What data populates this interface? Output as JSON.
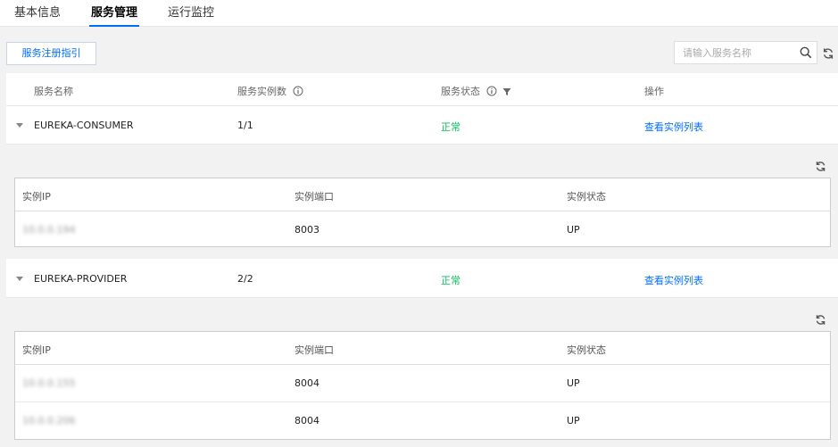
{
  "tabs": [
    "基本信息",
    "服务管理",
    "运行监控"
  ],
  "toolbar": {
    "guide_label": "服务注册指引",
    "search_placeholder": "请输入服务名称"
  },
  "table": {
    "headers": [
      "服务名称",
      "服务实例数",
      "服务状态",
      "操作"
    ],
    "services": [
      {
        "name": "EUREKA-CONSUMER",
        "instances": "1/1",
        "status": "正常",
        "action": "查看实例列表",
        "sub_headers": [
          "实例IP",
          "实例端口",
          "实例状态"
        ],
        "rows": [
          {
            "ip": "10.0.0.194",
            "port": "8003",
            "state": "UP"
          }
        ]
      },
      {
        "name": "EUREKA-PROVIDER",
        "instances": "2/2",
        "status": "正常",
        "action": "查看实例列表",
        "sub_headers": [
          "实例IP",
          "实例端口",
          "实例状态"
        ],
        "rows": [
          {
            "ip": "10.0.0.155",
            "port": "8004",
            "state": "UP"
          },
          {
            "ip": "10.0.0.206",
            "port": "8004",
            "state": "UP"
          }
        ]
      }
    ]
  },
  "colors": {
    "accent": "#006eff",
    "ok": "#0abf5b"
  }
}
